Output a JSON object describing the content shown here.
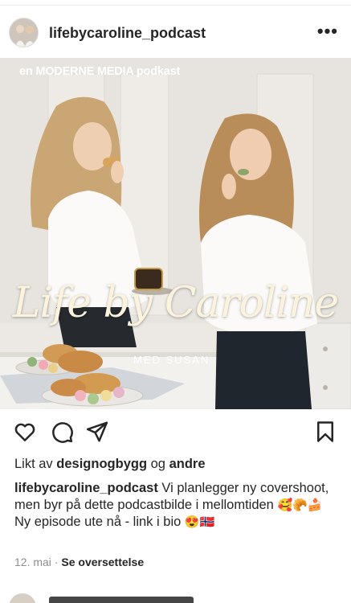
{
  "post": {
    "username": "lifebycaroline_podcast",
    "more_label": "•••",
    "photo": {
      "top_caption": "en MODERNE MEDIA podkast",
      "title": "Life by Caroline",
      "subtitle": "MED SUSAN"
    },
    "likes": {
      "prefix": "Likt av",
      "user": "designogbygg",
      "joiner": "og",
      "others": "andre"
    },
    "caption": {
      "author": "lifebycaroline_podcast",
      "text_1": "Vi planlegger ny covershoot, men byr på dette podcastbilde i mellomtiden",
      "emojis_1": "🥰🥐🍰",
      "text_2": "Ny episode ute nå - link i bio",
      "emojis_2": "😍🇳🇴"
    },
    "date": "12. mai",
    "separator": "·",
    "translate_label": "Se oversettelse"
  },
  "icons": [
    "heart-icon",
    "comment-icon",
    "share-icon",
    "bookmark-icon",
    "more-icon"
  ],
  "colors": {
    "text": "#262626",
    "muted": "#8e8e8e",
    "photo_bg": "#e9e6e1"
  }
}
